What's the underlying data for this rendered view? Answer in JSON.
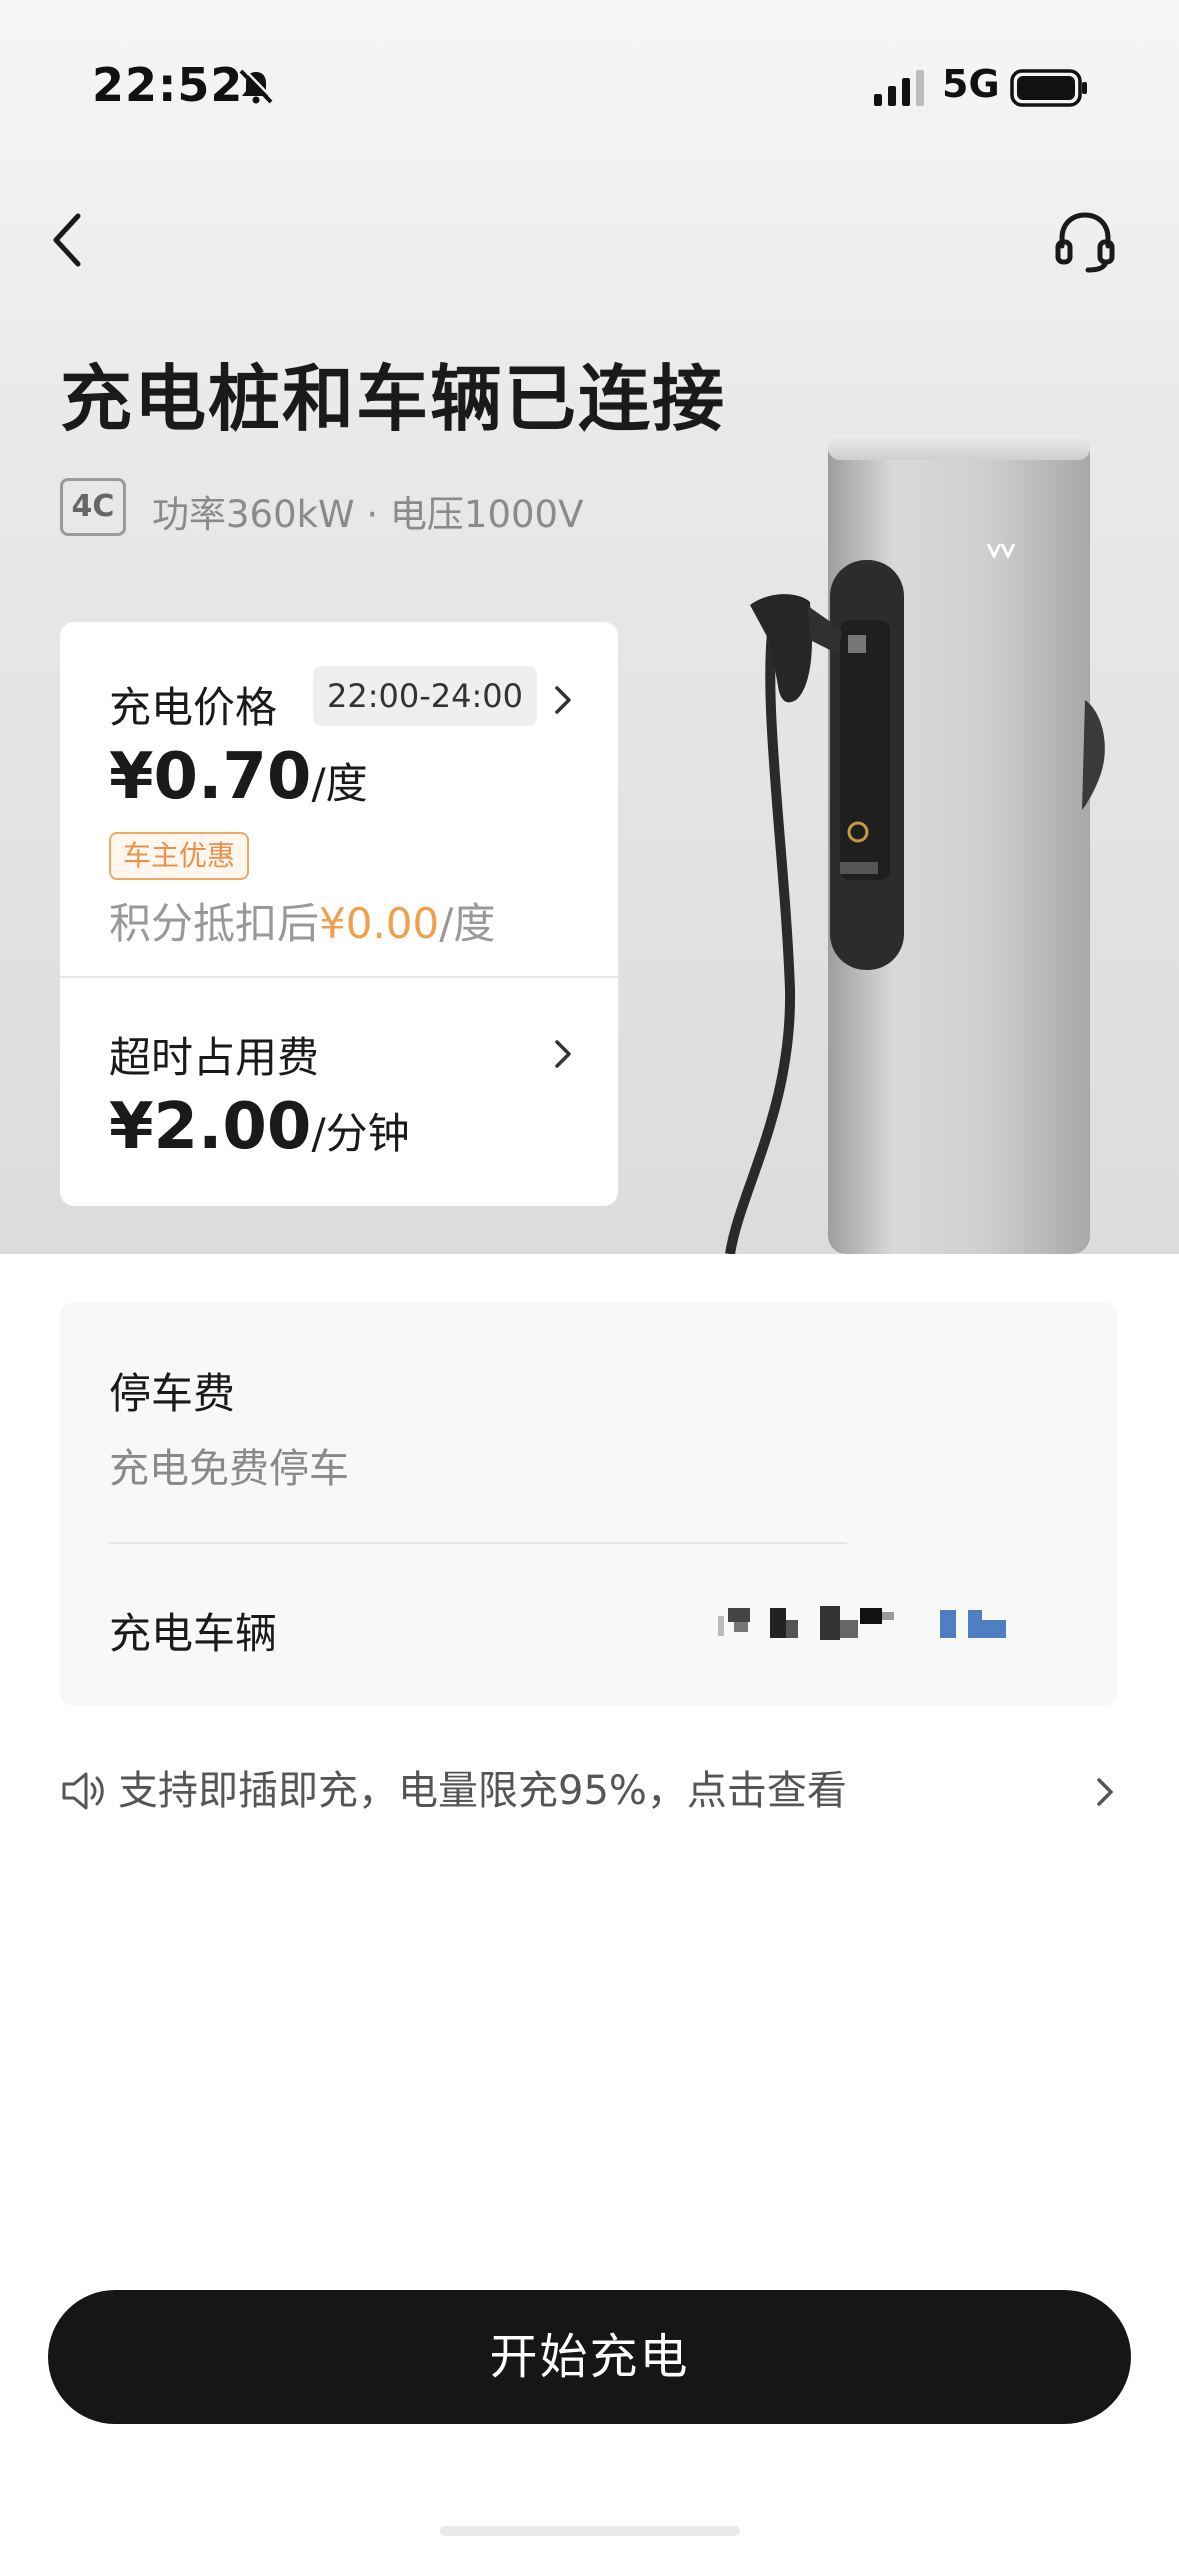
{
  "status_bar": {
    "time": "22:52",
    "network": "5G",
    "icons": [
      "bell-off-icon",
      "signal-icon",
      "battery-icon"
    ]
  },
  "header": {
    "back_icon": "chevron-left-icon",
    "support_icon": "headset-icon"
  },
  "title": "充电桩和车辆已连接",
  "spec": {
    "badge": "4C",
    "text": "功率360kW · 电压1000V"
  },
  "price_card": {
    "label": "充电价格",
    "time_range": "22:00-24:00",
    "price": "¥0.70",
    "price_unit": "/度",
    "tag": "车主优惠",
    "deduct_prefix": "积分抵扣后",
    "deduct_price": "¥0.00",
    "deduct_unit": "/度",
    "overtime_label": "超时占用费",
    "overtime_price": "¥2.00",
    "overtime_unit": "/分钟"
  },
  "info_card": {
    "parking_label": "停车费",
    "parking_value": "充电免费停车",
    "vehicle_label": "充电车辆"
  },
  "notice": {
    "icon": "speaker-icon",
    "text": "支持即插即充，电量限充95%，点击查看"
  },
  "action": {
    "start_label": "开始充电"
  },
  "colors": {
    "accent_orange": "#f0a04b",
    "button_bg": "#161616"
  }
}
